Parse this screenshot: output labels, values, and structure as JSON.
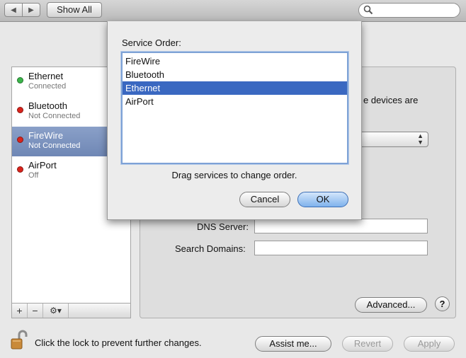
{
  "toolbar": {
    "show_all": "Show All",
    "search_placeholder": ""
  },
  "sidebar": {
    "services": [
      {
        "name": "Ethernet",
        "status": "Connected",
        "color": "#3bb54a"
      },
      {
        "name": "Bluetooth",
        "status": "Not Connected",
        "color": "#d9241c"
      },
      {
        "name": "FireWire",
        "status": "Not Connected",
        "color": "#d9241c"
      },
      {
        "name": "AirPort",
        "status": "Off",
        "color": "#d9241c"
      }
    ],
    "selected": "FireWire",
    "add": "+",
    "remove": "−",
    "action": "⚙▾"
  },
  "panel": {
    "partial_text": "e devices are",
    "dns_label": "DNS Server:",
    "search_domains_label": "Search Domains:",
    "dns_value": "",
    "search_domains_value": "",
    "advanced": "Advanced...",
    "help": "?"
  },
  "footer": {
    "lock_text": "Click the lock to prevent further changes.",
    "assist": "Assist me...",
    "revert": "Revert",
    "apply": "Apply"
  },
  "sheet": {
    "title": "Service Order:",
    "items": [
      "FireWire",
      "Bluetooth",
      "Ethernet",
      "AirPort"
    ],
    "selected": "Ethernet",
    "hint": "Drag services to change order.",
    "cancel": "Cancel",
    "ok": "OK"
  }
}
